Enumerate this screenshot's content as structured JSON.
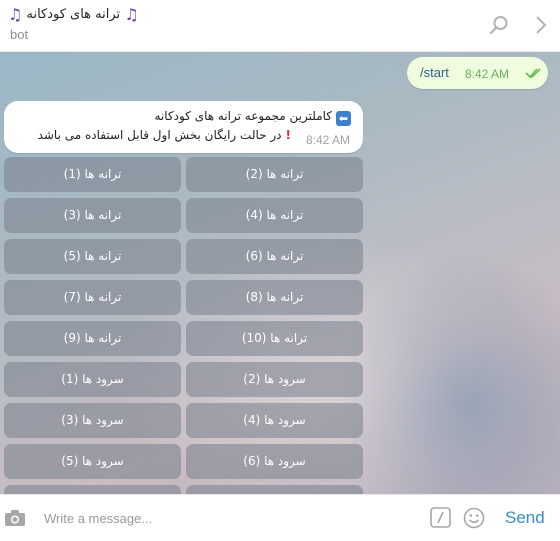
{
  "header": {
    "title": "ترانه های کودکانه",
    "subtitle": "bot",
    "title_emoji": "music-note",
    "icons": [
      "search-icon",
      "chevron-right-icon"
    ]
  },
  "messages": {
    "outgoing": {
      "text": "/start",
      "time": "8:42 AM",
      "status": "read"
    },
    "incoming": {
      "line1": "کاملترین مجموعه ترانه های کودکانه",
      "line2": "در حالت رایگان بخش اول قابل استفاده می باشد",
      "time": "8:42 AM"
    }
  },
  "keyboard": [
    [
      "ترانه ها (1)",
      "ترانه ها (2)"
    ],
    [
      "ترانه ها (3)",
      "ترانه ها (4)"
    ],
    [
      "ترانه ها (5)",
      "ترانه ها (6)"
    ],
    [
      "ترانه ها (7)",
      "ترانه ها (8)"
    ],
    [
      "ترانه ها (9)",
      "ترانه ها (10)"
    ],
    [
      "سرود ها (1)",
      "سرود ها (2)"
    ],
    [
      "سرود ها (3)",
      "سرود ها (4)"
    ],
    [
      "سرود ها (5)",
      "سرود ها (6)"
    ]
  ],
  "composer": {
    "placeholder": "Write a message...",
    "send_label": "Send"
  },
  "colors": {
    "accent": "#3a8ed1",
    "outgoing_bubble": "#effdde",
    "keyboard_button": "#7f8693"
  }
}
